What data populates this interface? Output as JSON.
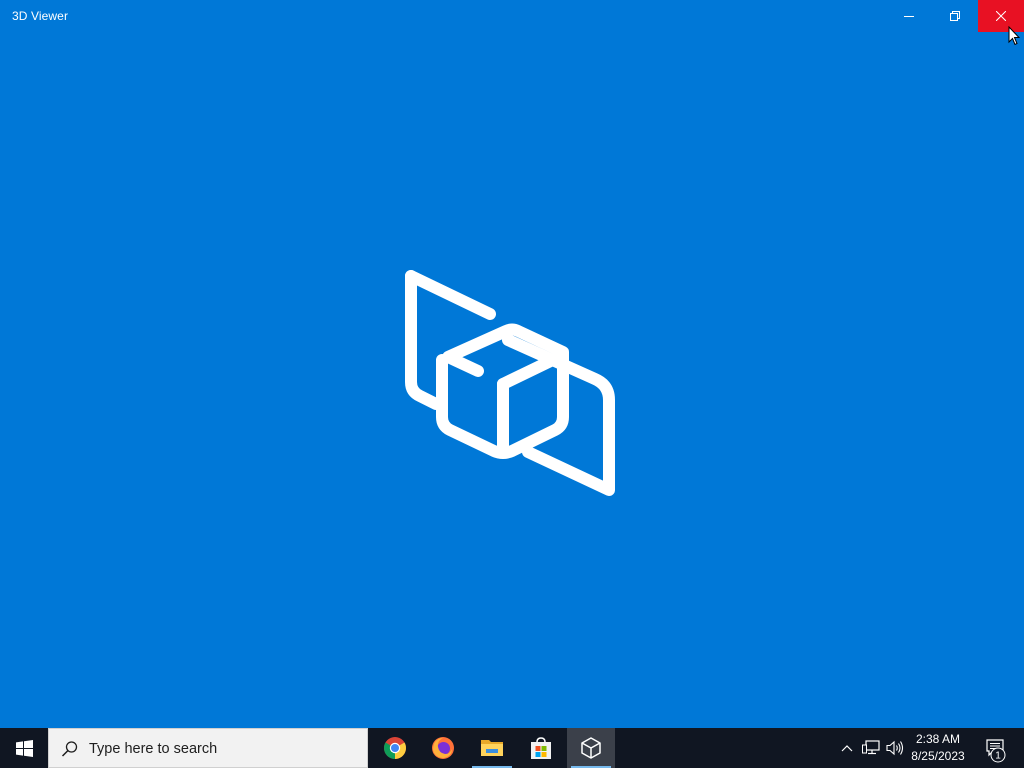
{
  "window": {
    "title": "3D Viewer",
    "background": "#0078d7",
    "controls": {
      "minimize_icon": "minimize-icon",
      "restore_icon": "restore-icon",
      "close_icon": "close-icon",
      "close_hover_color": "#e81123"
    },
    "splash_icon": "3d-viewer-logo-icon"
  },
  "taskbar": {
    "background": "#101622",
    "start_icon": "windows-logo-icon",
    "search": {
      "placeholder": "Type here to search",
      "icon": "search-icon"
    },
    "apps": [
      {
        "name": "Google Chrome",
        "icon": "chrome-icon"
      },
      {
        "name": "Firefox",
        "icon": "firefox-icon"
      },
      {
        "name": "File Explorer",
        "icon": "file-explorer-icon"
      },
      {
        "name": "Microsoft Store",
        "icon": "store-icon"
      },
      {
        "name": "3D Viewer",
        "icon": "3d-viewer-icon"
      }
    ],
    "tray": {
      "chevron_icon": "chevron-up-icon",
      "network_icon": "network-icon",
      "volume_icon": "volume-icon",
      "time": "2:38 AM",
      "date": "8/25/2023",
      "notifications_icon": "action-center-icon",
      "notification_count": "1"
    }
  }
}
